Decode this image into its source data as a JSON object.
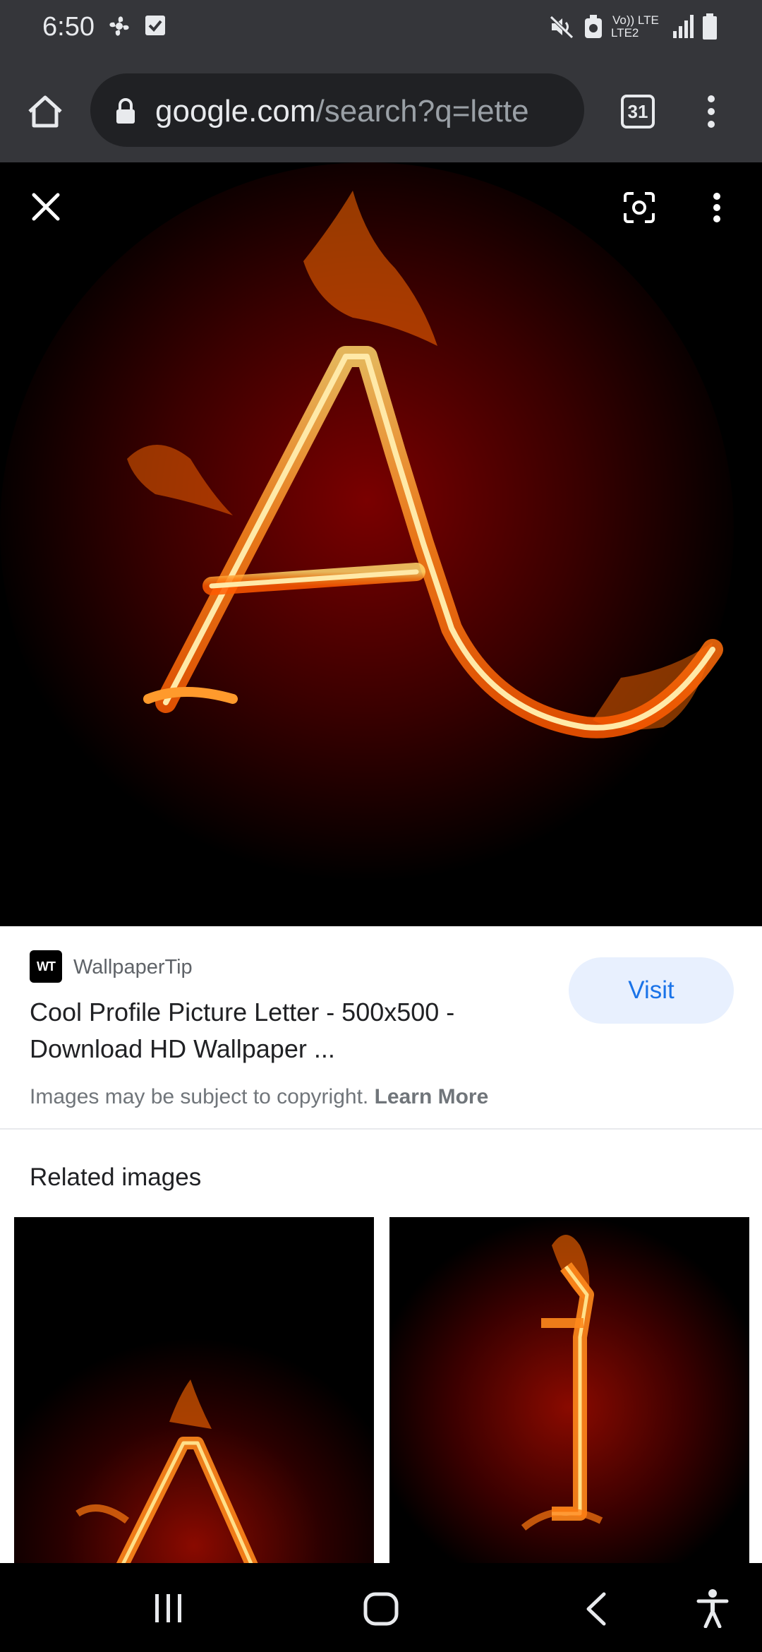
{
  "status_bar": {
    "time": "6:50",
    "network_label_top": "Vo)) LTE",
    "network_label_bottom": "LTE2",
    "icons": [
      "fan-icon",
      "checkbox-icon",
      "mute-icon",
      "alarm-icon",
      "signal-icon",
      "battery-icon"
    ]
  },
  "browser": {
    "url_domain": "google.com",
    "url_path": "/search?q=lette",
    "tab_count": "31",
    "icons": [
      "home-icon",
      "lock-icon",
      "tabs-icon",
      "menu-icon"
    ]
  },
  "viewer": {
    "icons": [
      "close-icon",
      "lens-icon",
      "more-options-icon"
    ]
  },
  "result": {
    "source_logo": "WT",
    "source_name": "WallpaperTip",
    "title": "Cool Profile Picture Letter - 500x500 - Download HD Wallpaper ...",
    "visit_label": "Visit",
    "copyright_text": "Images may be subject to copyright.",
    "learn_more_label": "Learn More"
  },
  "related": {
    "heading": "Related images"
  },
  "nav_bar": {
    "icons": [
      "recent-apps-icon",
      "home-button-icon",
      "back-icon",
      "accessibility-icon"
    ]
  },
  "colors": {
    "chrome_bg": "#35363a",
    "url_bar_bg": "#202124",
    "visit_bg": "#e8f0fe",
    "visit_text": "#1a73e8",
    "fire": "#ff8a1c"
  }
}
